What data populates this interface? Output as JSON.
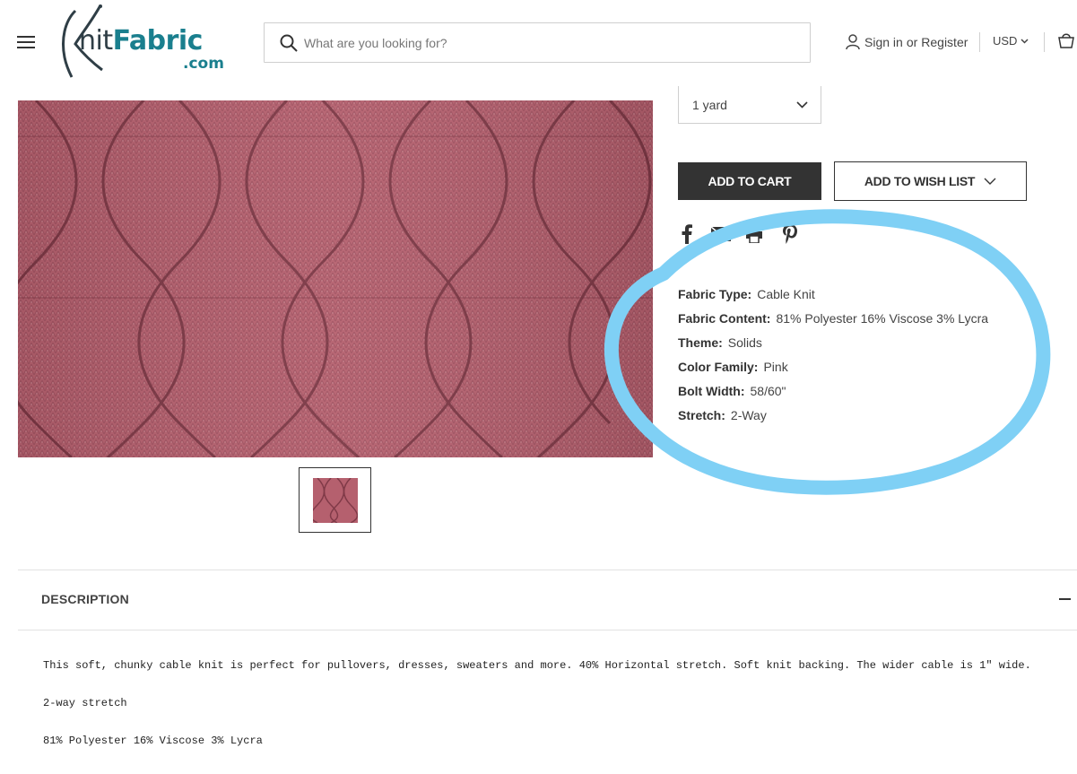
{
  "header": {
    "logo_main": "KnitFabric",
    "logo_sub": ".com",
    "search_placeholder": "What are you looking for?",
    "sign_in": "Sign in",
    "or": "or",
    "register": "Register",
    "currency": "USD"
  },
  "product": {
    "quantity_option": "1 yard",
    "add_to_cart": "ADD TO CART",
    "add_to_wish_list": "ADD TO WISH LIST",
    "share_icons": [
      "facebook-icon",
      "email-icon",
      "print-icon",
      "pinterest-icon"
    ],
    "image_color": "#b5606e"
  },
  "specs": [
    {
      "label": "Fabric Type:",
      "value": "Cable Knit"
    },
    {
      "label": "Fabric Content:",
      "value": "81% Polyester 16% Viscose 3% Lycra"
    },
    {
      "label": "Theme:",
      "value": "Solids"
    },
    {
      "label": "Color Family:",
      "value": "Pink"
    },
    {
      "label": "Bolt Width:",
      "value": "58/60\""
    },
    {
      "label": "Stretch:",
      "value": "2-Way"
    }
  ],
  "annotation_color": "#7fd0f5",
  "description": {
    "heading": "DESCRIPTION",
    "lines": [
      "This soft, chunky cable knit is perfect for pullovers, dresses, sweaters and more. 40% Horizontal stretch. Soft knit backing. The wider cable is 1\" wide.",
      "2-way stretch",
      "81% Polyester 16% Viscose 3% Lycra"
    ]
  }
}
